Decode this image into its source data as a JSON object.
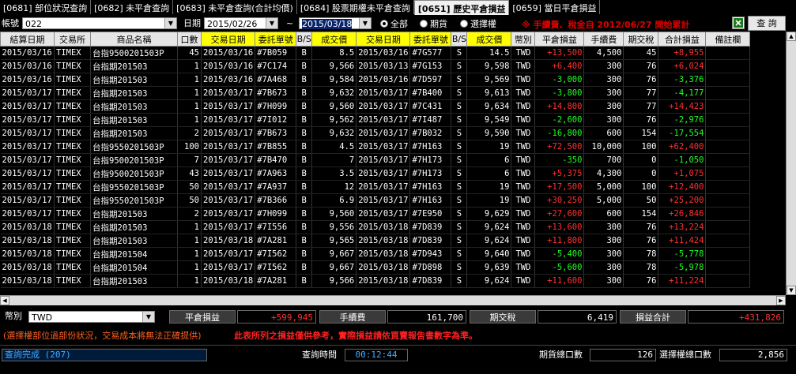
{
  "tabs": [
    {
      "label": "[0681] 部位狀況查詢",
      "active": false
    },
    {
      "label": "[0682] 未平倉查詢",
      "active": false
    },
    {
      "label": "[0683] 未平倉查詢(合計均價)",
      "active": false
    },
    {
      "label": "[0684] 股票期權未平倉查詢",
      "active": false
    },
    {
      "label": "[0651] 歷史平倉損益",
      "active": true
    },
    {
      "label": "[0659] 當日平倉損益",
      "active": false
    }
  ],
  "filter": {
    "account_label": "帳號",
    "account_value": "022",
    "date_label": "日期",
    "date_from": "2015/02/26",
    "date_sep": "~",
    "date_to": "2015/03/18",
    "radio_all": "全部",
    "radio_futures": "期貨",
    "radio_options": "選擇權",
    "warning": "※ 手續費、稅金自 2012/06/27 開始累計",
    "query_button": "查 詢"
  },
  "table": {
    "headers": [
      "結算日期",
      "交易所",
      "商品名稱",
      "口數",
      "交易日期",
      "委託單號",
      "B/S",
      "成交價",
      "交易日期",
      "委託單號",
      "B/S",
      "成交價",
      "幣別",
      "平倉損益",
      "手續費",
      "期交稅",
      "合計損益",
      "備註欄"
    ],
    "rows": [
      [
        "2015/03/16",
        "TIMEX",
        "台指9500201503P",
        "45",
        "2015/03/16",
        "#7B059",
        "B",
        "8.5",
        "2015/03/16",
        "#7G577",
        "S",
        "14.5",
        "TWD",
        "+13,500",
        "4,500",
        "45",
        "+8,955",
        ""
      ],
      [
        "2015/03/16",
        "TIMEX",
        "台指期201503",
        "1",
        "2015/03/16",
        "#7C174",
        "B",
        "9,566",
        "2015/03/13",
        "#7G153",
        "S",
        "9,598",
        "TWD",
        "+6,400",
        "300",
        "76",
        "+6,024",
        ""
      ],
      [
        "2015/03/16",
        "TIMEX",
        "台指期201503",
        "1",
        "2015/03/16",
        "#7A468",
        "B",
        "9,584",
        "2015/03/16",
        "#7D597",
        "S",
        "9,569",
        "TWD",
        "-3,000",
        "300",
        "76",
        "-3,376",
        ""
      ],
      [
        "2015/03/17",
        "TIMEX",
        "台指期201503",
        "1",
        "2015/03/17",
        "#7B673",
        "B",
        "9,632",
        "2015/03/17",
        "#7B400",
        "S",
        "9,613",
        "TWD",
        "-3,800",
        "300",
        "77",
        "-4,177",
        ""
      ],
      [
        "2015/03/17",
        "TIMEX",
        "台指期201503",
        "1",
        "2015/03/17",
        "#7H099",
        "B",
        "9,560",
        "2015/03/17",
        "#7C431",
        "S",
        "9,634",
        "TWD",
        "+14,800",
        "300",
        "77",
        "+14,423",
        ""
      ],
      [
        "2015/03/17",
        "TIMEX",
        "台指期201503",
        "1",
        "2015/03/17",
        "#7I012",
        "B",
        "9,562",
        "2015/03/17",
        "#7I487",
        "S",
        "9,549",
        "TWD",
        "-2,600",
        "300",
        "76",
        "-2,976",
        ""
      ],
      [
        "2015/03/17",
        "TIMEX",
        "台指期201503",
        "2",
        "2015/03/17",
        "#7B673",
        "B",
        "9,632",
        "2015/03/17",
        "#7B032",
        "S",
        "9,590",
        "TWD",
        "-16,800",
        "600",
        "154",
        "-17,554",
        ""
      ],
      [
        "2015/03/17",
        "TIMEX",
        "台指9550201503P",
        "100",
        "2015/03/17",
        "#7B855",
        "B",
        "4.5",
        "2015/03/17",
        "#7H163",
        "S",
        "19",
        "TWD",
        "+72,500",
        "10,000",
        "100",
        "+62,400",
        ""
      ],
      [
        "2015/03/17",
        "TIMEX",
        "台指9500201503P",
        "7",
        "2015/03/17",
        "#7B470",
        "B",
        "7",
        "2015/03/17",
        "#7H173",
        "S",
        "6",
        "TWD",
        "-350",
        "700",
        "0",
        "-1,050",
        ""
      ],
      [
        "2015/03/17",
        "TIMEX",
        "台指9500201503P",
        "43",
        "2015/03/17",
        "#7A963",
        "B",
        "3.5",
        "2015/03/17",
        "#7H173",
        "S",
        "6",
        "TWD",
        "+5,375",
        "4,300",
        "0",
        "+1,075",
        ""
      ],
      [
        "2015/03/17",
        "TIMEX",
        "台指9550201503P",
        "50",
        "2015/03/17",
        "#7A937",
        "B",
        "12",
        "2015/03/17",
        "#7H163",
        "S",
        "19",
        "TWD",
        "+17,500",
        "5,000",
        "100",
        "+12,400",
        ""
      ],
      [
        "2015/03/17",
        "TIMEX",
        "台指9550201503P",
        "50",
        "2015/03/17",
        "#7B366",
        "B",
        "6.9",
        "2015/03/17",
        "#7H163",
        "S",
        "19",
        "TWD",
        "+30,250",
        "5,000",
        "50",
        "+25,200",
        ""
      ],
      [
        "2015/03/17",
        "TIMEX",
        "台指期201503",
        "2",
        "2015/03/17",
        "#7H099",
        "B",
        "9,560",
        "2015/03/17",
        "#7E950",
        "S",
        "9,629",
        "TWD",
        "+27,600",
        "600",
        "154",
        "+26,846",
        ""
      ],
      [
        "2015/03/18",
        "TIMEX",
        "台指期201503",
        "1",
        "2015/03/17",
        "#7I556",
        "B",
        "9,556",
        "2015/03/18",
        "#7D839",
        "S",
        "9,624",
        "TWD",
        "+13,600",
        "300",
        "76",
        "+13,224",
        ""
      ],
      [
        "2015/03/18",
        "TIMEX",
        "台指期201503",
        "1",
        "2015/03/18",
        "#7A281",
        "B",
        "9,565",
        "2015/03/18",
        "#7D839",
        "S",
        "9,624",
        "TWD",
        "+11,800",
        "300",
        "76",
        "+11,424",
        ""
      ],
      [
        "2015/03/18",
        "TIMEX",
        "台指期201504",
        "1",
        "2015/03/17",
        "#7I562",
        "B",
        "9,667",
        "2015/03/18",
        "#7D943",
        "S",
        "9,640",
        "TWD",
        "-5,400",
        "300",
        "78",
        "-5,778",
        ""
      ],
      [
        "2015/03/18",
        "TIMEX",
        "台指期201504",
        "1",
        "2015/03/17",
        "#7I562",
        "B",
        "9,667",
        "2015/03/18",
        "#7D898",
        "S",
        "9,639",
        "TWD",
        "-5,600",
        "300",
        "78",
        "-5,978",
        ""
      ],
      [
        "2015/03/18",
        "TIMEX",
        "台指期201503",
        "1",
        "2015/03/18",
        "#7A281",
        "B",
        "9,566",
        "2015/03/18",
        "#7D839",
        "S",
        "9,624",
        "TWD",
        "+11,600",
        "300",
        "76",
        "+11,224",
        ""
      ]
    ]
  },
  "summary": {
    "currency_label": "幣別",
    "currency_value": "TWD",
    "pnl_label": "平倉損益",
    "pnl_value": "+599,945",
    "fee_label": "手續費",
    "fee_value": "161,700",
    "tax_label": "期交稅",
    "tax_value": "6,419",
    "total_label": "損益合計",
    "total_value": "+431,826"
  },
  "notice": {
    "left": "(選擇權部位過部份狀況，交易成本將無法正確提供)",
    "right": "此表所列之損益僅供參考，實際損益請依買賣報告書數字為準。"
  },
  "status": {
    "message": "查詢完成 (207)",
    "time_label": "查詢時間",
    "time_value": "00:12:44",
    "futures_label": "期貨總口數",
    "futures_value": "126",
    "options_label": "選擇權總口數",
    "options_value": "2,856"
  },
  "colors": {
    "profit": "#ff3030",
    "loss": "#20ff20",
    "warning": "#d00000",
    "header_highlight": "#ffff00"
  }
}
